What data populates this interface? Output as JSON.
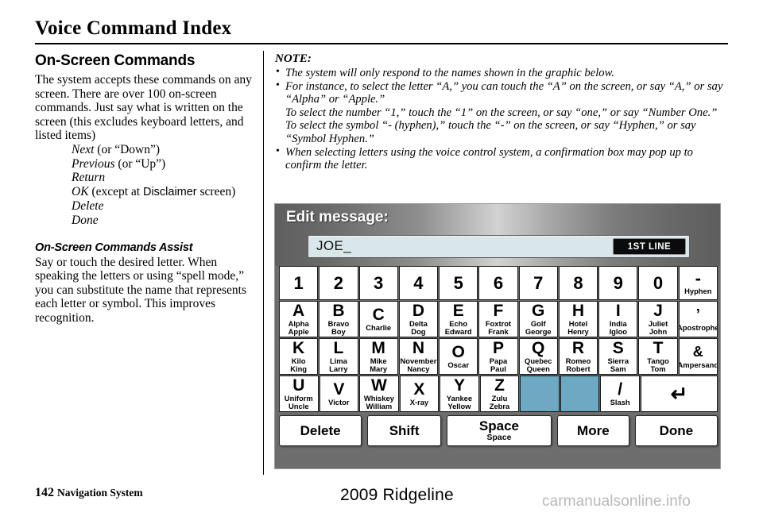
{
  "page": {
    "title": "Voice Command Index",
    "footer_page_number": "142",
    "footer_section": "Navigation System",
    "footer_model": "2009  Ridgeline",
    "watermark": "carmanualsonline.info"
  },
  "left_column": {
    "heading": "On-Screen Commands",
    "paragraph": "The system accepts these commands on any screen. There are over 100 on-screen commands. Just say what is written on the screen (this excludes keyboard letters, and listed items)",
    "commands": [
      {
        "name": "Next",
        "suffix": " (or “Down”)"
      },
      {
        "name": "Previous",
        "suffix": " (or “Up”)"
      },
      {
        "name": "Return",
        "suffix": ""
      },
      {
        "name": "OK",
        "suffix": " (except at ",
        "sans": "Disclaimer",
        "suffix2": " screen)"
      },
      {
        "name": "Delete",
        "suffix": ""
      },
      {
        "name": "Done",
        "suffix": ""
      }
    ],
    "assist_heading": "On-Screen Commands Assist",
    "assist_paragraph": "Say or touch the desired letter. When speaking the letters or using “spell mode,” you can substitute the name that represents each letter or symbol. This improves recognition."
  },
  "note": {
    "label": "NOTE:",
    "items": [
      {
        "text": "The system will only respond to the names shown in the graphic below.",
        "subs": []
      },
      {
        "text": "For instance, to select the letter “A,” you can touch the “A” on the screen, or say “A,” or say “Alpha” or “Apple.”",
        "subs": [
          "To select the number “1,” touch the “1” on the screen, or say “one,” or say “Number One.”",
          "To select the symbol “- (hyphen),” touch the “-” on the screen, or say “Hyphen,” or say “Symbol Hyphen.”"
        ]
      },
      {
        "text": "When selecting letters using the voice control system, a confirmation box may pop up to confirm the letter.",
        "subs": []
      }
    ]
  },
  "device": {
    "header_title": "Edit message:",
    "input_value": "JOE_",
    "line_badge": "1ST LINE",
    "colors": {
      "panel_bg": "#6d6d6d",
      "input_bg": "#d9e6ea",
      "disabled_key": "#6ea9c4",
      "badge_bg": "#0b0b0b"
    },
    "rows": [
      [
        {
          "glyph": "1",
          "subs": []
        },
        {
          "glyph": "2",
          "subs": []
        },
        {
          "glyph": "3",
          "subs": []
        },
        {
          "glyph": "4",
          "subs": []
        },
        {
          "glyph": "5",
          "subs": []
        },
        {
          "glyph": "6",
          "subs": []
        },
        {
          "glyph": "7",
          "subs": []
        },
        {
          "glyph": "8",
          "subs": []
        },
        {
          "glyph": "9",
          "subs": []
        },
        {
          "glyph": "0",
          "subs": []
        },
        {
          "glyph": "-",
          "subs": [
            "Hyphen"
          ]
        }
      ],
      [
        {
          "glyph": "A",
          "subs": [
            "Alpha",
            "Apple"
          ]
        },
        {
          "glyph": "B",
          "subs": [
            "Bravo",
            "Boy"
          ]
        },
        {
          "glyph": "C",
          "subs": [
            "Charlie"
          ]
        },
        {
          "glyph": "D",
          "subs": [
            "Delta",
            "Dog"
          ]
        },
        {
          "glyph": "E",
          "subs": [
            "Echo",
            "Edward"
          ]
        },
        {
          "glyph": "F",
          "subs": [
            "Foxtrot",
            "Frank"
          ]
        },
        {
          "glyph": "G",
          "subs": [
            "Golf",
            "George"
          ]
        },
        {
          "glyph": "H",
          "subs": [
            "Hotel",
            "Henry"
          ]
        },
        {
          "glyph": "I",
          "subs": [
            "India",
            "Igloo"
          ]
        },
        {
          "glyph": "J",
          "subs": [
            "Juliet",
            "John"
          ]
        },
        {
          "glyph": "’",
          "subs": [
            "Apostrophe"
          ]
        }
      ],
      [
        {
          "glyph": "K",
          "subs": [
            "Kilo",
            "King"
          ]
        },
        {
          "glyph": "L",
          "subs": [
            "Lima",
            "Larry"
          ]
        },
        {
          "glyph": "M",
          "subs": [
            "Mike",
            "Mary"
          ]
        },
        {
          "glyph": "N",
          "subs": [
            "November",
            "Nancy"
          ]
        },
        {
          "glyph": "O",
          "subs": [
            "Oscar"
          ]
        },
        {
          "glyph": "P",
          "subs": [
            "Papa",
            "Paul"
          ]
        },
        {
          "glyph": "Q",
          "subs": [
            "Quebec",
            "Queen"
          ]
        },
        {
          "glyph": "R",
          "subs": [
            "Romeo",
            "Robert"
          ]
        },
        {
          "glyph": "S",
          "subs": [
            "Sierra",
            "Sam"
          ]
        },
        {
          "glyph": "T",
          "subs": [
            "Tango",
            "Tom"
          ]
        },
        {
          "glyph": "&",
          "subs": [
            "Ampersand"
          ]
        }
      ],
      [
        {
          "glyph": "U",
          "subs": [
            "Uniform",
            "Uncle"
          ]
        },
        {
          "glyph": "V",
          "subs": [
            "Victor"
          ]
        },
        {
          "glyph": "W",
          "subs": [
            "Whiskey",
            "William"
          ]
        },
        {
          "glyph": "X",
          "subs": [
            "X-ray"
          ]
        },
        {
          "glyph": "Y",
          "subs": [
            "Yankee",
            "Yellow"
          ]
        },
        {
          "glyph": "Z",
          "subs": [
            "Zulu",
            "Zebra"
          ]
        },
        {
          "glyph": "",
          "subs": [],
          "disabled": true
        },
        {
          "glyph": "",
          "subs": [],
          "disabled": true
        },
        {
          "glyph": "/",
          "subs": [
            "Slash"
          ]
        },
        {
          "glyph": "↵",
          "subs": [],
          "wide": true,
          "icon": "return-arrow-icon"
        }
      ]
    ],
    "actions": [
      {
        "label": "Delete",
        "sub": ""
      },
      {
        "label": "Shift",
        "sub": ""
      },
      {
        "label": "Space",
        "sub": "Space"
      },
      {
        "label": "More",
        "sub": ""
      },
      {
        "label": "Done",
        "sub": ""
      }
    ]
  }
}
